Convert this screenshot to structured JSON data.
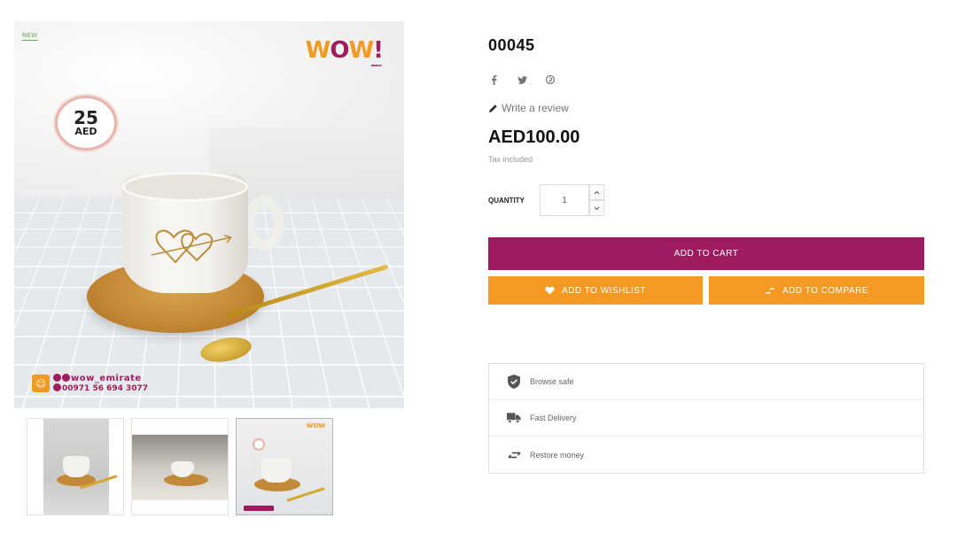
{
  "product": {
    "title": "00045",
    "review_label": "Write a review",
    "price": "AED100.00",
    "tax_note": "Tax included",
    "quantity_label": "QUANTITY",
    "quantity_value": "1"
  },
  "image": {
    "new_badge": "NEW",
    "logo_letters": [
      "W",
      "O",
      "W"
    ],
    "logo_exclaim": "!",
    "logo_sub": "BY EVE SHOP",
    "price_badge_value": "25",
    "price_badge_currency": "AED",
    "watermark_handle": "wow_emirate",
    "watermark_phone": "00971 56 694 3077"
  },
  "thumbnails": [
    {
      "name": "thumb-1"
    },
    {
      "name": "thumb-2"
    },
    {
      "name": "thumb-3"
    }
  ],
  "social": [
    "facebook-icon",
    "twitter-icon",
    "pinterest-icon"
  ],
  "buttons": {
    "add_to_cart": "ADD TO CART",
    "add_to_wishlist": "ADD TO WISHLIST",
    "add_to_compare": "ADD TO COMPARE"
  },
  "reassurance": [
    {
      "icon": "shield-check-icon",
      "label": "Browse safe"
    },
    {
      "icon": "truck-icon",
      "label": "Fast Delivery"
    },
    {
      "icon": "swap-arrows-icon",
      "label": "Restore money"
    }
  ],
  "colors": {
    "primary": "#9e1b5f",
    "accent": "#f49a24",
    "new_badge": "#5cae4f"
  }
}
